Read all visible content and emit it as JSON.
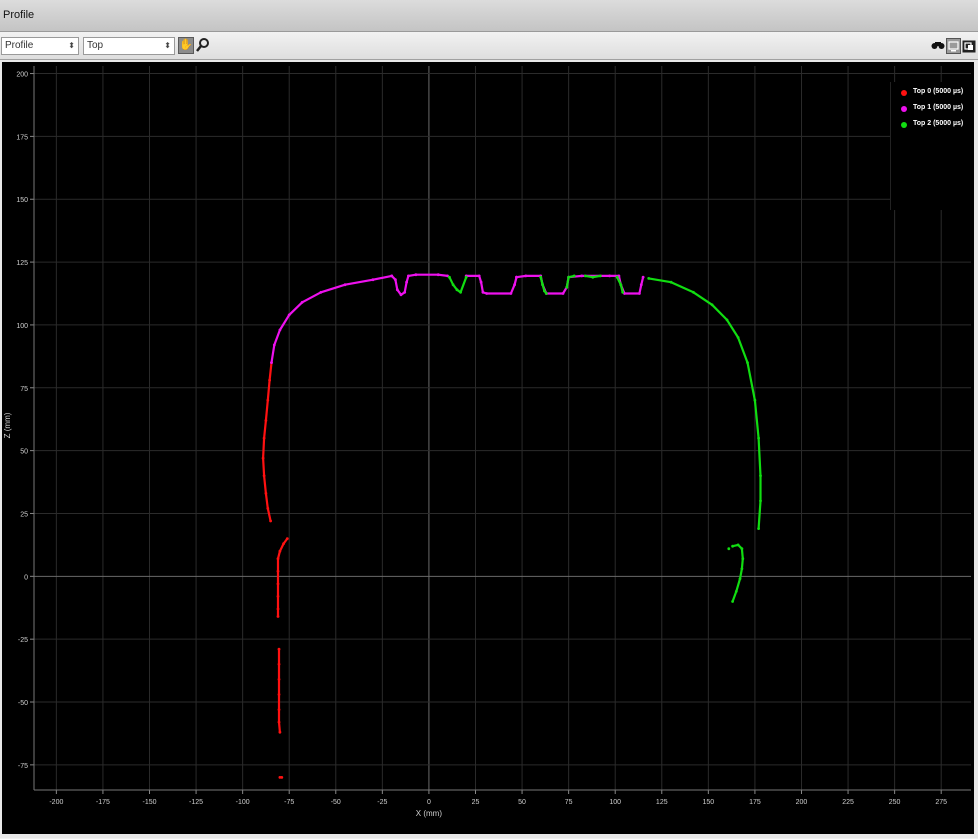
{
  "window": {
    "title": "Profile"
  },
  "toolbar": {
    "view_select": "Profile",
    "source_select": "Top",
    "icons": [
      "hand-icon",
      "zoom-icon",
      "binoculars-icon",
      "monitor-icon",
      "restore-icon"
    ]
  },
  "chart_data": {
    "type": "scatter",
    "xlabel": "X (mm)",
    "ylabel": "Z (mm)",
    "xlim": [
      -212,
      291
    ],
    "ylim": [
      -85,
      203
    ],
    "x_ticks": [
      "-200",
      "-175",
      "-150",
      "-125",
      "-100",
      "-75",
      "-50",
      "-25",
      "0",
      "25",
      "50",
      "75",
      "100",
      "125",
      "150",
      "175",
      "200",
      "225",
      "250",
      "275"
    ],
    "y_ticks": [
      "200",
      "175",
      "150",
      "125",
      "100",
      "75",
      "50",
      "25",
      "0",
      "-25",
      "-50",
      "-75"
    ],
    "grid": true,
    "legend_position": "top-right",
    "series": [
      {
        "name": "Top 0 (5000 µs)",
        "color": "#ff1111",
        "segments": [
          [
            [
              -84.5,
              85
            ],
            [
              -85.5,
              78
            ],
            [
              -86.5,
              70
            ],
            [
              -87.5,
              62
            ],
            [
              -88.5,
              55
            ],
            [
              -89,
              47
            ],
            [
              -88.5,
              40
            ],
            [
              -87.5,
              33
            ],
            [
              -86.5,
              27
            ],
            [
              -85,
              22
            ]
          ],
          [
            [
              -76,
              15
            ],
            [
              -78,
              13
            ],
            [
              -80,
              10
            ],
            [
              -81,
              7
            ],
            [
              -81,
              2
            ],
            [
              -81,
              -3
            ],
            [
              -81,
              -8
            ],
            [
              -81,
              -13
            ],
            [
              -81,
              -16
            ]
          ],
          [
            [
              -80.5,
              -29
            ],
            [
              -80.5,
              -35
            ],
            [
              -80.5,
              -41
            ],
            [
              -80.5,
              -47
            ],
            [
              -80.5,
              -53
            ],
            [
              -80.5,
              -58
            ],
            [
              -80,
              -62
            ]
          ],
          [
            [
              -80,
              -80
            ],
            [
              -79,
              -80
            ]
          ]
        ]
      },
      {
        "name": "Top 1 (5000 µs)",
        "color": "#ee11ee",
        "segments": [
          [
            [
              -84.5,
              85
            ],
            [
              -83,
              92
            ],
            [
              -80,
              98
            ],
            [
              -75,
              104
            ],
            [
              -68,
              109
            ],
            [
              -58,
              113
            ],
            [
              -45,
              116
            ],
            [
              -30,
              118
            ],
            [
              -20,
              119.5
            ]
          ],
          [
            [
              -20,
              119.5
            ],
            [
              -18,
              118
            ],
            [
              -17,
              114
            ],
            [
              -15,
              112
            ],
            [
              -13,
              113
            ],
            [
              -12,
              117
            ],
            [
              -11,
              119.5
            ],
            [
              -7,
              120
            ],
            [
              5,
              120
            ],
            [
              10,
              119.5
            ]
          ],
          [
            [
              20,
              119.5
            ],
            [
              27,
              119.5
            ],
            [
              28,
              117
            ],
            [
              29,
              113
            ],
            [
              31,
              112.5
            ],
            [
              44,
              112.5
            ],
            [
              46,
              116
            ],
            [
              47,
              119
            ]
          ],
          [
            [
              47,
              119
            ],
            [
              52,
              119.5
            ],
            [
              60,
              119.5
            ],
            [
              61,
              116
            ],
            [
              63,
              112.5
            ],
            [
              72,
              112.5
            ],
            [
              74,
              115
            ],
            [
              75,
              119
            ],
            [
              82,
              119.5
            ],
            [
              97,
              119.5
            ],
            [
              102,
              119.5
            ],
            [
              103,
              116
            ],
            [
              105,
              112.5
            ],
            [
              113,
              112.5
            ],
            [
              114,
              116
            ],
            [
              115,
              119
            ]
          ]
        ]
      },
      {
        "name": "Top 2 (5000 µs)",
        "color": "#11dd11",
        "segments": [
          [
            [
              11,
              119
            ],
            [
              13,
              116
            ],
            [
              15,
              114
            ],
            [
              17,
              113
            ],
            [
              20,
              119
            ]
          ],
          [
            [
              60,
              119
            ],
            [
              61,
              116
            ],
            [
              62,
              113.5
            ],
            [
              63,
              112.5
            ]
          ],
          [
            [
              74,
              115
            ],
            [
              75,
              119
            ],
            [
              78,
              119.5
            ]
          ],
          [
            [
              84,
              119.5
            ],
            [
              88,
              119
            ],
            [
              92,
              119.5
            ]
          ],
          [
            [
              101,
              119
            ],
            [
              103,
              116
            ],
            [
              104,
              113
            ]
          ],
          [
            [
              118,
              118.5
            ],
            [
              130,
              117
            ],
            [
              142,
              113
            ],
            [
              152,
              108
            ],
            [
              160,
              102
            ],
            [
              166,
              95
            ],
            [
              171,
              85
            ],
            [
              175,
              70
            ],
            [
              177,
              55
            ],
            [
              178,
              40
            ],
            [
              178,
              30
            ],
            [
              177,
              19
            ]
          ],
          [
            [
              163,
              12
            ],
            [
              166,
              12.5
            ],
            [
              168,
              11
            ],
            [
              168.5,
              7
            ],
            [
              168,
              3
            ],
            [
              167,
              -1
            ],
            [
              165,
              -6
            ],
            [
              163,
              -10
            ]
          ],
          [
            [
              161,
              11
            ]
          ]
        ]
      }
    ]
  }
}
